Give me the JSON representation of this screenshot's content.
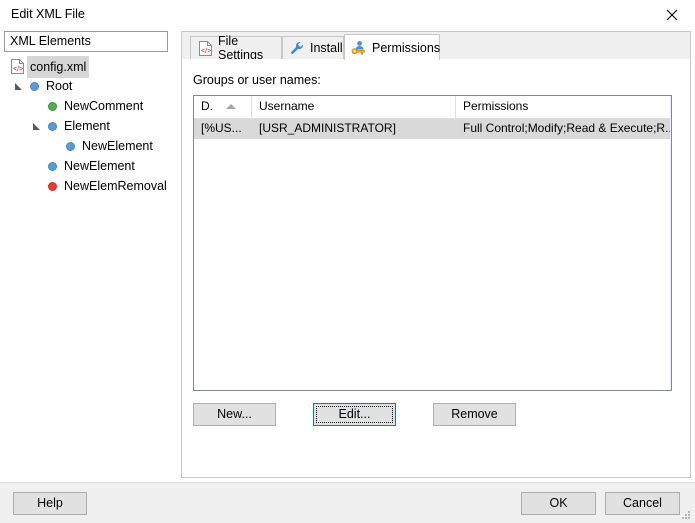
{
  "window": {
    "title": "Edit XML File",
    "close_icon": "close-icon"
  },
  "tree": {
    "header": "XML Elements",
    "nodes": [
      {
        "label": "config.xml",
        "icon": "xml-file-icon",
        "indent": 0,
        "twisty": "",
        "bullet": "",
        "selected": true
      },
      {
        "label": "Root",
        "icon": "bullet",
        "indent": 1,
        "twisty": "expanded",
        "bullet": "blue",
        "selected": false
      },
      {
        "label": "NewComment",
        "icon": "bullet",
        "indent": 2,
        "twisty": "",
        "bullet": "green",
        "selected": false
      },
      {
        "label": "Element",
        "icon": "bullet",
        "indent": 2,
        "twisty": "expanded",
        "bullet": "blue",
        "selected": false
      },
      {
        "label": "NewElement",
        "icon": "bullet",
        "indent": 3,
        "twisty": "",
        "bullet": "blue",
        "selected": false
      },
      {
        "label": "NewElement",
        "icon": "bullet",
        "indent": 2,
        "twisty": "",
        "bullet": "blue",
        "selected": false
      },
      {
        "label": "NewElemRemoval",
        "icon": "bullet",
        "indent": 2,
        "twisty": "",
        "bullet": "red",
        "selected": false
      }
    ]
  },
  "tabs": [
    {
      "label": "File Settings",
      "icon": "xml-file-icon",
      "active": false
    },
    {
      "label": "Install",
      "icon": "wrench-icon",
      "active": false
    },
    {
      "label": "Permissions",
      "icon": "user-key-icon",
      "active": true
    }
  ],
  "permissions_page": {
    "group_label": "Groups or user names:",
    "columns": [
      {
        "key": "domain",
        "label": "D.",
        "sorted": "asc"
      },
      {
        "key": "username",
        "label": "Username",
        "sorted": ""
      },
      {
        "key": "permissions",
        "label": "Permissions",
        "sorted": ""
      }
    ],
    "rows": [
      {
        "domain": "[%US...",
        "username": "[USR_ADMINISTRATOR]",
        "permissions": "Full Control;Modify;Read & Execute;R...",
        "selected": true
      }
    ],
    "buttons": {
      "new": "New...",
      "edit": "Edit...",
      "remove": "Remove"
    }
  },
  "footer": {
    "help": "Help",
    "ok": "OK",
    "cancel": "Cancel"
  },
  "colors": {
    "accent": "#0078d7",
    "selection": "#d9d9d9",
    "node_blue": "#5b9bd5",
    "node_green": "#4caf50",
    "node_red": "#e23c33",
    "chrome": "#f0f0f0"
  }
}
